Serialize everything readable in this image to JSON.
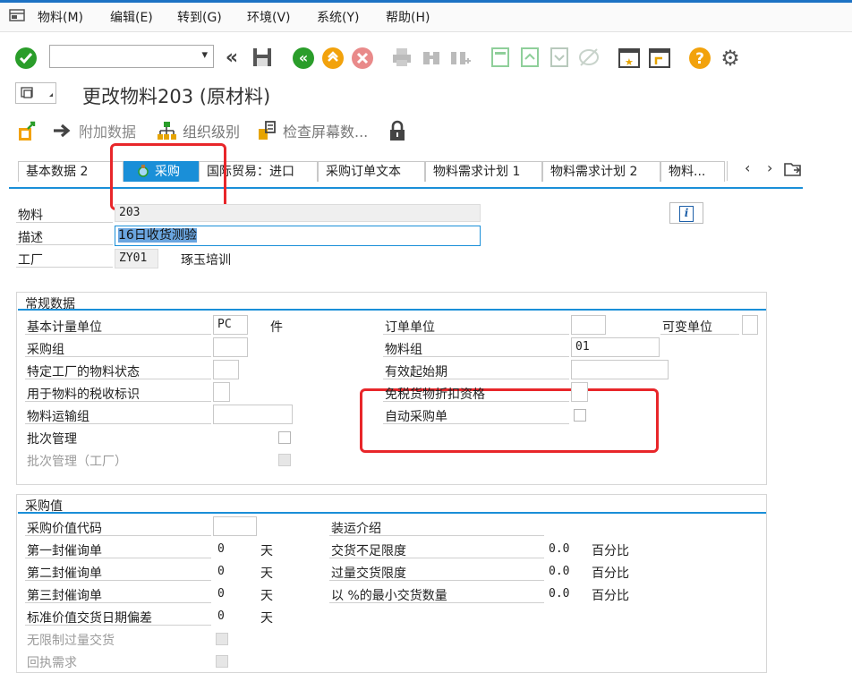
{
  "menu": {
    "items": [
      {
        "label": "物料(M)"
      },
      {
        "label": "编辑(E)"
      },
      {
        "label": "转到(G)"
      },
      {
        "label": "环境(V)"
      },
      {
        "label": "系统(Y)"
      },
      {
        "label": "帮助(H)"
      }
    ]
  },
  "toolbar": {
    "command_value": ""
  },
  "title": "更改物料203 (原材料)",
  "subtoolbar": {
    "additional_data": "附加数据",
    "org_levels": "组织级别",
    "check_screen": "检查屏幕数..."
  },
  "tabs": [
    {
      "label": "基本数据 2"
    },
    {
      "label": "采购",
      "active": true
    },
    {
      "label": "国际贸易：进口"
    },
    {
      "label": "采购订单文本"
    },
    {
      "label": "物料需求计划 1"
    },
    {
      "label": "物料需求计划 2"
    },
    {
      "label": "物料..."
    }
  ],
  "header": {
    "material_label": "物料",
    "material_value": "203",
    "desc_label": "描述",
    "desc_value": "16日收货测验",
    "plant_label": "工厂",
    "plant_value": "ZY01",
    "plant_name": "琢玉培训"
  },
  "general": {
    "title": "常规数据",
    "base_uom_label": "基本计量单位",
    "base_uom_value": "PC",
    "base_uom_text": "件",
    "order_unit_label": "订单单位",
    "order_unit_value": "",
    "var_unit_label": "可变单位",
    "purch_group_label": "采购组",
    "purch_group_value": "",
    "mat_group_label": "物料组",
    "mat_group_value": "01",
    "plant_status_label": "特定工厂的物料状态",
    "plant_status_value": "",
    "valid_from_label": "有效起始期",
    "valid_from_value": "",
    "tax_label": "用于物料的税收标识",
    "tax_value": "",
    "discount_label": "免税货物折扣资格",
    "transport_label": "物料运输组",
    "transport_value": "",
    "auto_po_label": "自动采购单",
    "batch_label": "批次管理",
    "batch_plant_label": "批次管理（工厂）"
  },
  "purch_values": {
    "title": "采购值",
    "pv_key_label": "采购价值代码",
    "pv_key_value": "",
    "shipping_label": "装运介绍",
    "rem1_label": "第一封催询单",
    "rem1_value": "0",
    "rem1_unit": "天",
    "under_label": "交货不足限度",
    "under_value": "0.0",
    "under_unit": "百分比",
    "rem2_label": "第二封催询单",
    "rem2_value": "0",
    "rem2_unit": "天",
    "over_label": "过量交货限度",
    "over_value": "0.0",
    "over_unit": "百分比",
    "rem3_label": "第三封催询单",
    "rem3_value": "0",
    "rem3_unit": "天",
    "min_qty_label": "以 %的最小交货数量",
    "min_qty_value": "0.0",
    "min_qty_unit": "百分比",
    "dev_label": "标准价值交货日期偏差",
    "dev_value": "0",
    "dev_unit": "天",
    "unlimited_label": "无限制过量交货",
    "ack_label": "回执需求"
  }
}
